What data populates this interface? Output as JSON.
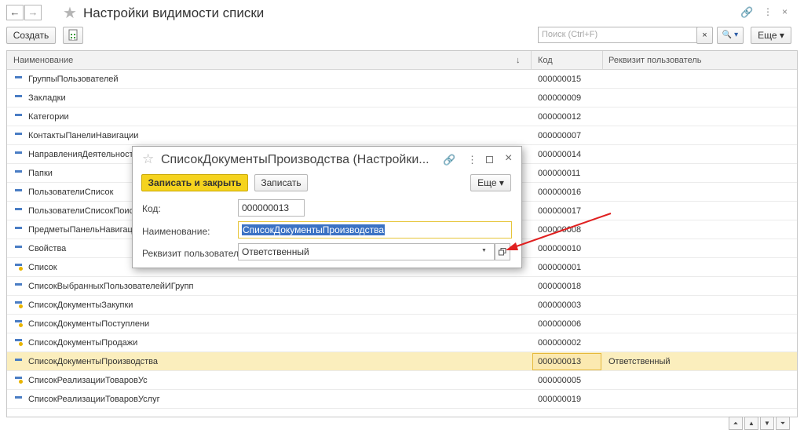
{
  "window": {
    "title": "Настройки видимости списки"
  },
  "toolbar": {
    "create_label": "Создать",
    "search_placeholder": "Поиск (Ctrl+F)",
    "clear_label": "×",
    "search_btn_label": "🔍 ▾",
    "more_label": "Еще ▾"
  },
  "grid": {
    "columns": [
      "Наименование",
      "Код",
      "Реквизит пользователь"
    ],
    "sort_indicator": "↓",
    "rows": [
      {
        "name": "ГруппыПользователей",
        "code": "000000015",
        "requisite": "",
        "icon": "dash"
      },
      {
        "name": "Закладки",
        "code": "000000009",
        "requisite": "",
        "icon": "dash"
      },
      {
        "name": "Категории",
        "code": "000000012",
        "requisite": "",
        "icon": "dash"
      },
      {
        "name": "КонтактыПанелиНавигации",
        "code": "000000007",
        "requisite": "",
        "icon": "dash"
      },
      {
        "name": "НаправленияДеятельности",
        "code": "000000014",
        "requisite": "",
        "icon": "dash"
      },
      {
        "name": "Папки",
        "code": "000000011",
        "requisite": "",
        "icon": "dash"
      },
      {
        "name": "ПользователиСписок",
        "code": "000000016",
        "requisite": "",
        "icon": "dash"
      },
      {
        "name": "ПользователиСписокПоиск",
        "code": "000000017",
        "requisite": "",
        "icon": "dash"
      },
      {
        "name": "ПредметыПанельНавигации",
        "code": "000000008",
        "requisite": "",
        "icon": "dash"
      },
      {
        "name": "Свойства",
        "code": "000000010",
        "requisite": "",
        "icon": "dash"
      },
      {
        "name": "Список",
        "code": "000000001",
        "requisite": "",
        "icon": "key"
      },
      {
        "name": "СписокВыбранныхПользователейИГрупп",
        "code": "000000018",
        "requisite": "",
        "icon": "dash"
      },
      {
        "name": "СписокДокументыЗакупки",
        "code": "000000003",
        "requisite": "",
        "icon": "key"
      },
      {
        "name": "СписокДокументыПоступлени",
        "code": "000000006",
        "requisite": "",
        "icon": "key"
      },
      {
        "name": "СписокДокументыПродажи",
        "code": "000000002",
        "requisite": "",
        "icon": "key"
      },
      {
        "name": "СписокДокументыПроизводства",
        "code": "000000013",
        "requisite": "Ответственный",
        "icon": "dash",
        "selected": true
      },
      {
        "name": "СписокРеализацииТоваровУс",
        "code": "000000005",
        "requisite": "",
        "icon": "key"
      },
      {
        "name": "СписокРеализацииТоваровУслуг",
        "code": "000000019",
        "requisite": "",
        "icon": "dash"
      }
    ]
  },
  "dialog": {
    "title": "СписокДокументыПроизводства (Настройки...",
    "save_close_label": "Записать и закрыть",
    "save_label": "Записать",
    "more_label": "Еще ▾",
    "code_label": "Код:",
    "code_value": "000000013",
    "name_label": "Наименование:",
    "name_value": "СписокДокументыПроизводства",
    "requisite_label": "Реквизит пользователь:",
    "requisite_value": "Ответственный"
  },
  "colors": {
    "accent_yellow": "#f5d31e",
    "selection_row": "#fbeebd",
    "arrow_red": "#e02020",
    "list_icon_blue": "#4a7dc4"
  }
}
